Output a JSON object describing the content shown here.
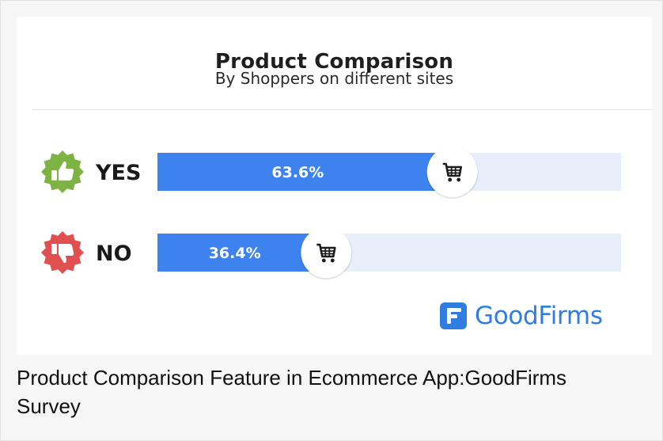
{
  "chart_data": {
    "type": "bar",
    "orientation": "horizontal",
    "title": "Product Comparison",
    "subtitle": "By Shoppers on different sites",
    "categories": [
      "YES",
      "NO"
    ],
    "values": [
      63.6,
      36.4
    ],
    "value_labels": [
      "63.6%",
      "36.4%"
    ],
    "xlim": [
      0,
      100
    ],
    "grid": false,
    "colors": {
      "bar": "#3d82ee",
      "track": "#e9eefb",
      "yes_icon": "#7cb342",
      "no_icon": "#e05050"
    },
    "icons": [
      "thumbs-up-icon",
      "thumbs-down-icon",
      "cart-icon"
    ]
  },
  "brand": {
    "name": "GoodFirms",
    "color": "#2f7de0"
  },
  "caption": "Product Comparison Feature in Ecommerce App:GoodFirms Survey"
}
